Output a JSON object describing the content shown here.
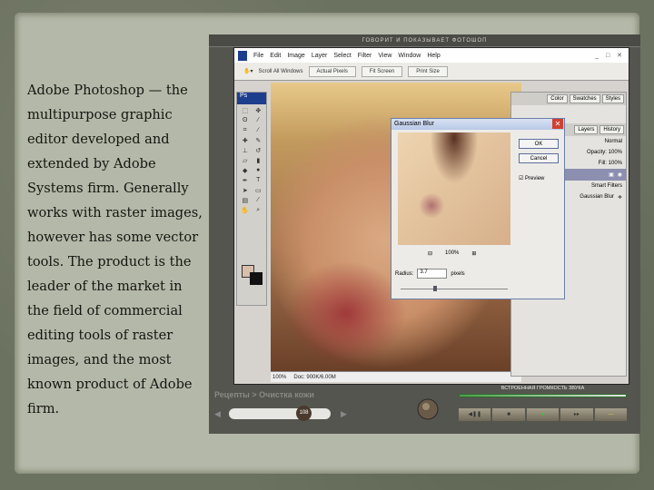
{
  "slide_text": "Adobe Photoshop — the multipurpose graphic editor developed and extended by Adobe Systems firm. Generally works with raster images, however has some vector tools. The product is the leader of the market in the field of commercial editing tools of raster images, and the most known product of Adobe firm.",
  "player": {
    "title": "ГОВОРИТ И ПОКАЗЫВАЕТ ФОТОШОП",
    "breadcrumb": "Рецепты > Очистка кожи",
    "position": "108",
    "volume_label": "ВСТРОЕННАЯ ГРОМКОСТЬ ЗВУКА",
    "controls": [
      "◀❚❚",
      "■",
      "●",
      "▸▸",
      "—"
    ]
  },
  "photoshop": {
    "logo": "Ps",
    "menu": [
      "File",
      "Edit",
      "Image",
      "Layer",
      "Select",
      "Filter",
      "View",
      "Window",
      "Help"
    ],
    "window_buttons": "_ □ ✕",
    "options": {
      "scroll_all": "Scroll All Windows",
      "actual_pixels": "Actual Pixels",
      "fit_screen": "Fit Screen",
      "print_size": "Print Size"
    },
    "status": {
      "zoom": "100%",
      "doc": "Doc: 900K/6.00M"
    },
    "panels": {
      "tabs1": [
        "Color",
        "Swatches",
        "Styles"
      ],
      "tabs2": [
        "Layers",
        "History"
      ],
      "blend": "Normal",
      "opacity": "Opacity: 100%",
      "fill": "Fill: 100%",
      "smart_filters": "Smart Filters",
      "gaussian": "Gaussian Blur"
    },
    "dialog": {
      "title": "Gaussian Blur",
      "ok": "OK",
      "cancel": "Cancel",
      "preview": "Preview",
      "zoom": "100%",
      "radius_label": "Radius:",
      "radius": "3.7",
      "unit": "pixels"
    }
  }
}
